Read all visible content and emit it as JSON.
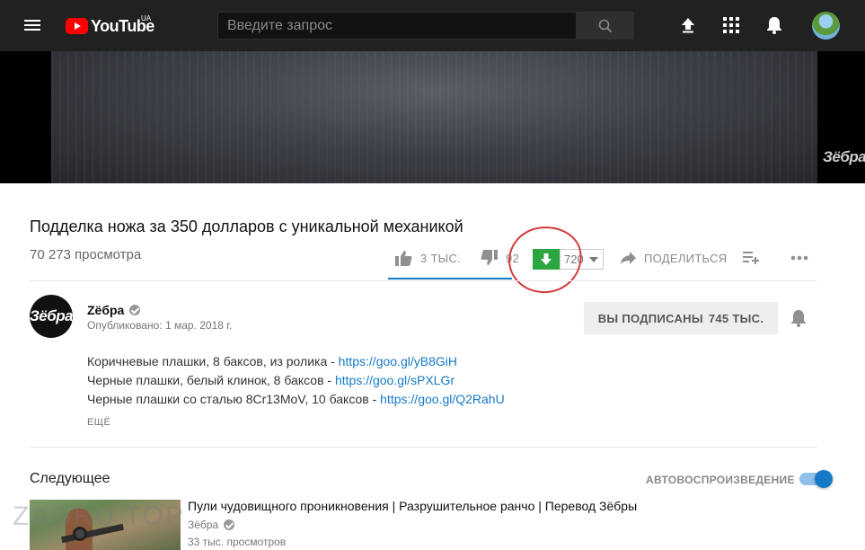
{
  "header": {
    "logo_text": "YouTube",
    "logo_region": "UA",
    "search_placeholder": "Введите запрос",
    "icons": [
      "menu-icon",
      "search-icon",
      "upload-icon",
      "apps-icon",
      "notifications-icon",
      "account-avatar"
    ]
  },
  "player": {
    "watermark": "Зёбра"
  },
  "video": {
    "title": "Подделка ножа за 350 долларов с уникальной механикой",
    "views": "70 273 просмотра",
    "likes_label": "3 ТЫС.",
    "dislikes_label": "92",
    "downloads_count": "720",
    "share_label": "ПОДЕЛИТЬСЯ",
    "like_ratio": 1.0
  },
  "channel": {
    "avatar_text": "Зёбра",
    "name": "Zёбра",
    "published": "Опубликовано: 1 мар. 2018 г.",
    "subscribe_label": "ВЫ ПОДПИСАНЫ",
    "subscriber_count": "745 ТЫС."
  },
  "description": {
    "lines": [
      {
        "text": "Коричневые плашки, 8 баксов, из ролика - ",
        "link": "https://goo.gl/yB8GiH"
      },
      {
        "text": "Черные плашки, белый клинок, 8 баксов - ",
        "link": "https://goo.gl/sPXLGr"
      },
      {
        "text": "Черные плашки со сталью 8Cr13MoV, 10 баксов - ",
        "link": "https://goo.gl/Q2RahU"
      }
    ],
    "more_label": "ЕЩЁ"
  },
  "up_next": {
    "label": "Следующее",
    "autoplay_label": "АВТОВОСПРОИЗВЕДЕНИЕ",
    "autoplay_on": true,
    "item": {
      "title": "Пули чудовищного проникновения | Разрушительное ранчо | Перевод Зёбры",
      "channel": "Зёбра",
      "views": "33 тыс. просмотров"
    }
  },
  "overlay": {
    "site_watermark": "ZAGRU TOP"
  },
  "colors": {
    "topbar": "#212121",
    "accent_blue": "#167ac6",
    "download_green": "#2ba640",
    "annotation_red": "#d43a3a"
  }
}
